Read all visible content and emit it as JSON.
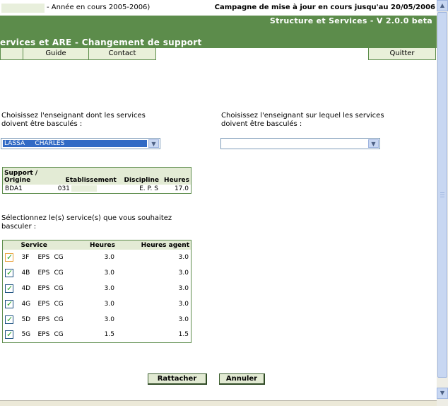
{
  "top": {
    "year_text": "- Année en cours 2005-2006)",
    "campaign_text": "Campagne de mise à jour en cours jusqu'au 20/05/2006"
  },
  "header": {
    "app_name": "Structure et Services - V 2.0.0 beta",
    "page_title": "ervices et ARE - Changement de support"
  },
  "nav": {
    "guide": "Guide",
    "contact": "Contact",
    "quit": "Quitter"
  },
  "source": {
    "label": "Choisissez l'enseignant dont les services doivent être basculés :",
    "selected": "LASSA     CHARLES"
  },
  "target": {
    "label": "Choisissez l'enseignant sur lequel les services doivent être basculés :",
    "selected": ""
  },
  "support_table": {
    "headers": {
      "support": "Support / Origine",
      "etablissement": "Etablissement",
      "discipline": "Discipline",
      "heures": "Heures"
    },
    "row": {
      "support": "BDA1",
      "etablissement": "031",
      "discipline": "E. P. S",
      "heures": "17.0"
    }
  },
  "services": {
    "label": "Sélectionnez le(s) service(s) que vous souhaitez basculer :",
    "headers": {
      "service": "Service",
      "heures": "Heures",
      "heures_agent": "Heures agent"
    },
    "rows": [
      {
        "code": "3F",
        "disc": "EPS",
        "type": "CG",
        "heures": "3.0",
        "heures_agent": "3.0",
        "checked": true
      },
      {
        "code": "4B",
        "disc": "EPS",
        "type": "CG",
        "heures": "3.0",
        "heures_agent": "3.0",
        "checked": true
      },
      {
        "code": "4D",
        "disc": "EPS",
        "type": "CG",
        "heures": "3.0",
        "heures_agent": "3.0",
        "checked": true
      },
      {
        "code": "4G",
        "disc": "EPS",
        "type": "CG",
        "heures": "3.0",
        "heures_agent": "3.0",
        "checked": true
      },
      {
        "code": "5D",
        "disc": "EPS",
        "type": "CG",
        "heures": "3.0",
        "heures_agent": "3.0",
        "checked": true
      },
      {
        "code": "5G",
        "disc": "EPS",
        "type": "CG",
        "heures": "1.5",
        "heures_agent": "1.5",
        "checked": true
      }
    ]
  },
  "buttons": {
    "attach": "Rattacher",
    "cancel": "Annuler"
  },
  "icons": {
    "dropdown": "chevron-down-icon",
    "checkbox": "checkmark-icon"
  },
  "colors": {
    "header_green": "#5c8c4b",
    "nav_bg": "#e9f0d9",
    "selection_blue": "#316ac5"
  }
}
